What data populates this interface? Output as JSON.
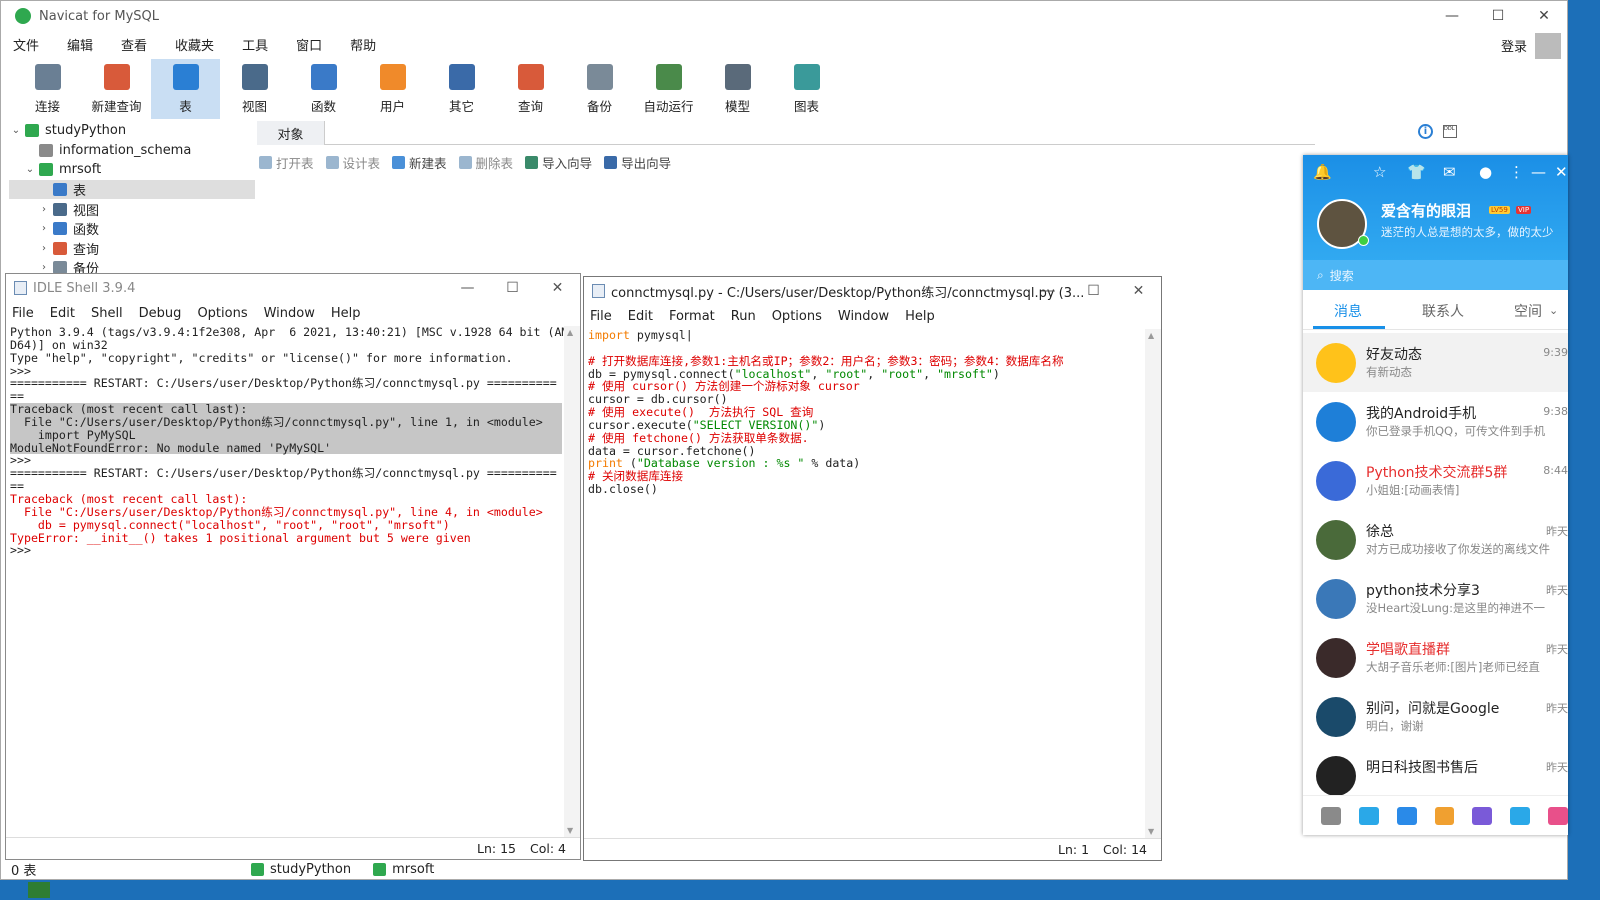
{
  "navicat": {
    "title": "Navicat for MySQL",
    "menu": [
      "文件",
      "编辑",
      "查看",
      "收藏夹",
      "工具",
      "窗口",
      "帮助"
    ],
    "login": "登录",
    "toolbar": [
      {
        "label": "连接",
        "icon": "plug-icon",
        "color": "#6a7f94"
      },
      {
        "label": "新建查询",
        "icon": "new-query-icon",
        "color": "#d85a3a"
      },
      {
        "label": "表",
        "icon": "table-icon",
        "color": "#2a7fd4"
      },
      {
        "label": "视图",
        "icon": "view-icon",
        "color": "#4a6a8a"
      },
      {
        "label": "函数",
        "icon": "function-icon",
        "color": "#3a7ac8"
      },
      {
        "label": "用户",
        "icon": "user-icon",
        "color": "#f08a2a"
      },
      {
        "label": "其它",
        "icon": "tools-icon",
        "color": "#3a6aa8"
      },
      {
        "label": "查询",
        "icon": "query-icon",
        "color": "#d85a3a"
      },
      {
        "label": "备份",
        "icon": "backup-icon",
        "color": "#7a8a98"
      },
      {
        "label": "自动运行",
        "icon": "schedule-icon",
        "color": "#4a8a4a"
      },
      {
        "label": "模型",
        "icon": "model-icon",
        "color": "#5a6a7a"
      },
      {
        "label": "图表",
        "icon": "chart-icon",
        "color": "#3a9a9a"
      }
    ],
    "tree": [
      {
        "label": "studyPython",
        "indent": 0,
        "arrow": "v",
        "color": "#2fa84f"
      },
      {
        "label": "information_schema",
        "indent": 1,
        "arrow": "",
        "color": "#8a8a8a"
      },
      {
        "label": "mrsoft",
        "indent": 1,
        "arrow": "v",
        "color": "#2fa84f"
      },
      {
        "label": "表",
        "indent": 2,
        "arrow": "",
        "color": "#3a7ac8",
        "sel": true
      },
      {
        "label": "视图",
        "indent": 2,
        "arrow": ">",
        "color": "#4a6a8a"
      },
      {
        "label": "函数",
        "indent": 2,
        "arrow": ">",
        "color": "#3a7ac8"
      },
      {
        "label": "查询",
        "indent": 2,
        "arrow": ">",
        "color": "#d85a3a"
      },
      {
        "label": "备份",
        "indent": 2,
        "arrow": ">",
        "color": "#7a8a98"
      }
    ],
    "object_tab": "对象",
    "object_bar": [
      "打开表",
      "设计表",
      "新建表",
      "删除表",
      "导入向导",
      "导出向导"
    ],
    "info_icon": "i",
    "ddl_icon": "DDL",
    "status_count": "0 表",
    "status_dbs": [
      "studyPython",
      "mrsoft"
    ]
  },
  "shell": {
    "title": "IDLE Shell 3.9.4",
    "menu": [
      "File",
      "Edit",
      "Shell",
      "Debug",
      "Options",
      "Window",
      "Help"
    ],
    "lines": [
      {
        "t": "Python 3.9.4 (tags/v3.9.4:1f2e308, Apr  6 2021, 13:40:21) [MSC v.1928 64 bit (AM",
        "c": ""
      },
      {
        "t": "D64)] on win32",
        "c": ""
      },
      {
        "t": "Type \"help\", \"copyright\", \"credits\" or \"license()\" for more information.",
        "c": ""
      },
      {
        "t": ">>> ",
        "c": ""
      },
      {
        "t": "=========== RESTART: C:/Users/user/Desktop/Python练习/connctmysql.py ==========",
        "c": ""
      },
      {
        "t": "==",
        "c": ""
      },
      {
        "t": "Traceback (most recent call last):",
        "c": "hl"
      },
      {
        "t": "  File \"C:/Users/user/Desktop/Python练习/connctmysql.py\", line 1, in <module>",
        "c": "hl"
      },
      {
        "t": "    import PyMySQL",
        "c": "hl"
      },
      {
        "t": "ModuleNotFoundError: No module named 'PyMySQL'",
        "c": "hl"
      },
      {
        "t": ">>> ",
        "c": ""
      },
      {
        "t": "=========== RESTART: C:/Users/user/Desktop/Python练习/connctmysql.py ==========",
        "c": ""
      },
      {
        "t": "==",
        "c": ""
      },
      {
        "t": "Traceback (most recent call last):",
        "c": "red"
      },
      {
        "t": "  File \"C:/Users/user/Desktop/Python练习/connctmysql.py\", line 4, in <module>",
        "c": "red"
      },
      {
        "t": "    db = pymysql.connect(\"localhost\", \"root\", \"root\", \"mrsoft\")",
        "c": "red"
      },
      {
        "t": "TypeError: __init__() takes 1 positional argument but 5 were given",
        "c": "red"
      },
      {
        "t": ">>> ",
        "c": ""
      }
    ],
    "status_ln": "Ln: 15",
    "status_col": "Col: 4"
  },
  "editor": {
    "title": "connctmysql.py - C:/Users/user/Desktop/Python练习/connctmysql.py (3...",
    "menu": [
      "File",
      "Edit",
      "Format",
      "Run",
      "Options",
      "Window",
      "Help"
    ],
    "status_ln": "Ln: 1",
    "status_col": "Col: 14"
  },
  "qq": {
    "nickname": "爱含有的眼泪",
    "level_badge": "LV59",
    "vip_badge": "VIP",
    "signature": "迷茫的人总是想的太多，做的太少",
    "search_placeholder": "搜索",
    "tabs": [
      "消息",
      "联系人",
      "空间"
    ],
    "items": [
      {
        "name": "好友动态",
        "preview": "有新动态",
        "time": "9:39",
        "color": "#ffc21a",
        "red": false,
        "sel": true
      },
      {
        "name": "我的Android手机",
        "preview": "你已登录手机QQ，可传文件到手机",
        "time": "9:38",
        "color": "#1e7fd8",
        "red": false
      },
      {
        "name": "Python技术交流群5群",
        "preview": "小姐姐:[动画表情]",
        "time": "8:44",
        "color": "#3a6ad8",
        "red": true
      },
      {
        "name": "徐总",
        "preview": "对方已成功接收了你发送的离线文件",
        "time": "昨天",
        "color": "#4a6a3a",
        "red": false
      },
      {
        "name": "python技术分享3",
        "preview": "没Heart没Lung:是这里的神进不一",
        "time": "昨天",
        "color": "#3a78b8",
        "red": false
      },
      {
        "name": "学唱歌直播群",
        "preview": "大胡子音乐老师:[图片]老师已经直",
        "time": "昨天",
        "color": "#3a2a2a",
        "red": true
      },
      {
        "name": "别问，问就是Google",
        "preview": "明白，谢谢",
        "time": "昨天",
        "color": "#1a4a6a",
        "red": false
      },
      {
        "name": "明日科技图书售后",
        "preview": "",
        "time": "昨天",
        "color": "#222222",
        "red": false
      }
    ],
    "bottom_colors": [
      "#8a8a8a",
      "#2aa8e8",
      "#2a8ae8",
      "#f0a030",
      "#7a5ad8",
      "#2aa8e8",
      "#e8508a"
    ]
  }
}
